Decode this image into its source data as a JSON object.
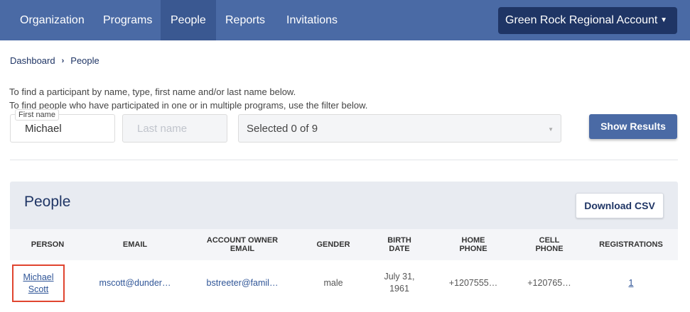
{
  "nav": {
    "items": [
      {
        "label": "Organization",
        "active": false
      },
      {
        "label": "Programs",
        "active": false
      },
      {
        "label": "People",
        "active": true
      },
      {
        "label": "Reports",
        "active": false
      },
      {
        "label": "Invitations",
        "active": false
      }
    ],
    "account": "Green Rock Regional Account",
    "account_caret": "▼"
  },
  "breadcrumb": {
    "home": "Dashboard",
    "separator": "›",
    "current": "People"
  },
  "help": {
    "line1": "To find a participant by name, type, first name and/or last name below.",
    "line2": "To find people who have participated in one or in multiple programs, use the filter below."
  },
  "filters": {
    "first_name_label": "First name",
    "first_name_value": "Michael",
    "last_name_placeholder": "Last name",
    "programs_selected": "Selected 0 of 9",
    "show_results": "Show Results"
  },
  "people": {
    "title": "People",
    "download_csv": "Download CSV",
    "columns": [
      "PERSON",
      "EMAIL",
      "ACCOUNT OWNER EMAIL",
      "GENDER",
      "BIRTH DATE",
      "HOME PHONE",
      "CELL PHONE",
      "REGISTRATIONS"
    ],
    "rows": [
      {
        "person": "Michael Scott",
        "email": "mscott@dunder…",
        "owner_email": "bstreeter@famil…",
        "gender": "male",
        "birth_date": "July 31, 1961",
        "home_phone": "+1207555…",
        "cell_phone": "+120765…",
        "registrations": "1"
      }
    ]
  },
  "colors": {
    "nav_bg": "#4a6aa5",
    "nav_active": "#3a5891",
    "account_bg": "#1f3565",
    "highlight": "#e0452f",
    "link": "#2f5597"
  }
}
